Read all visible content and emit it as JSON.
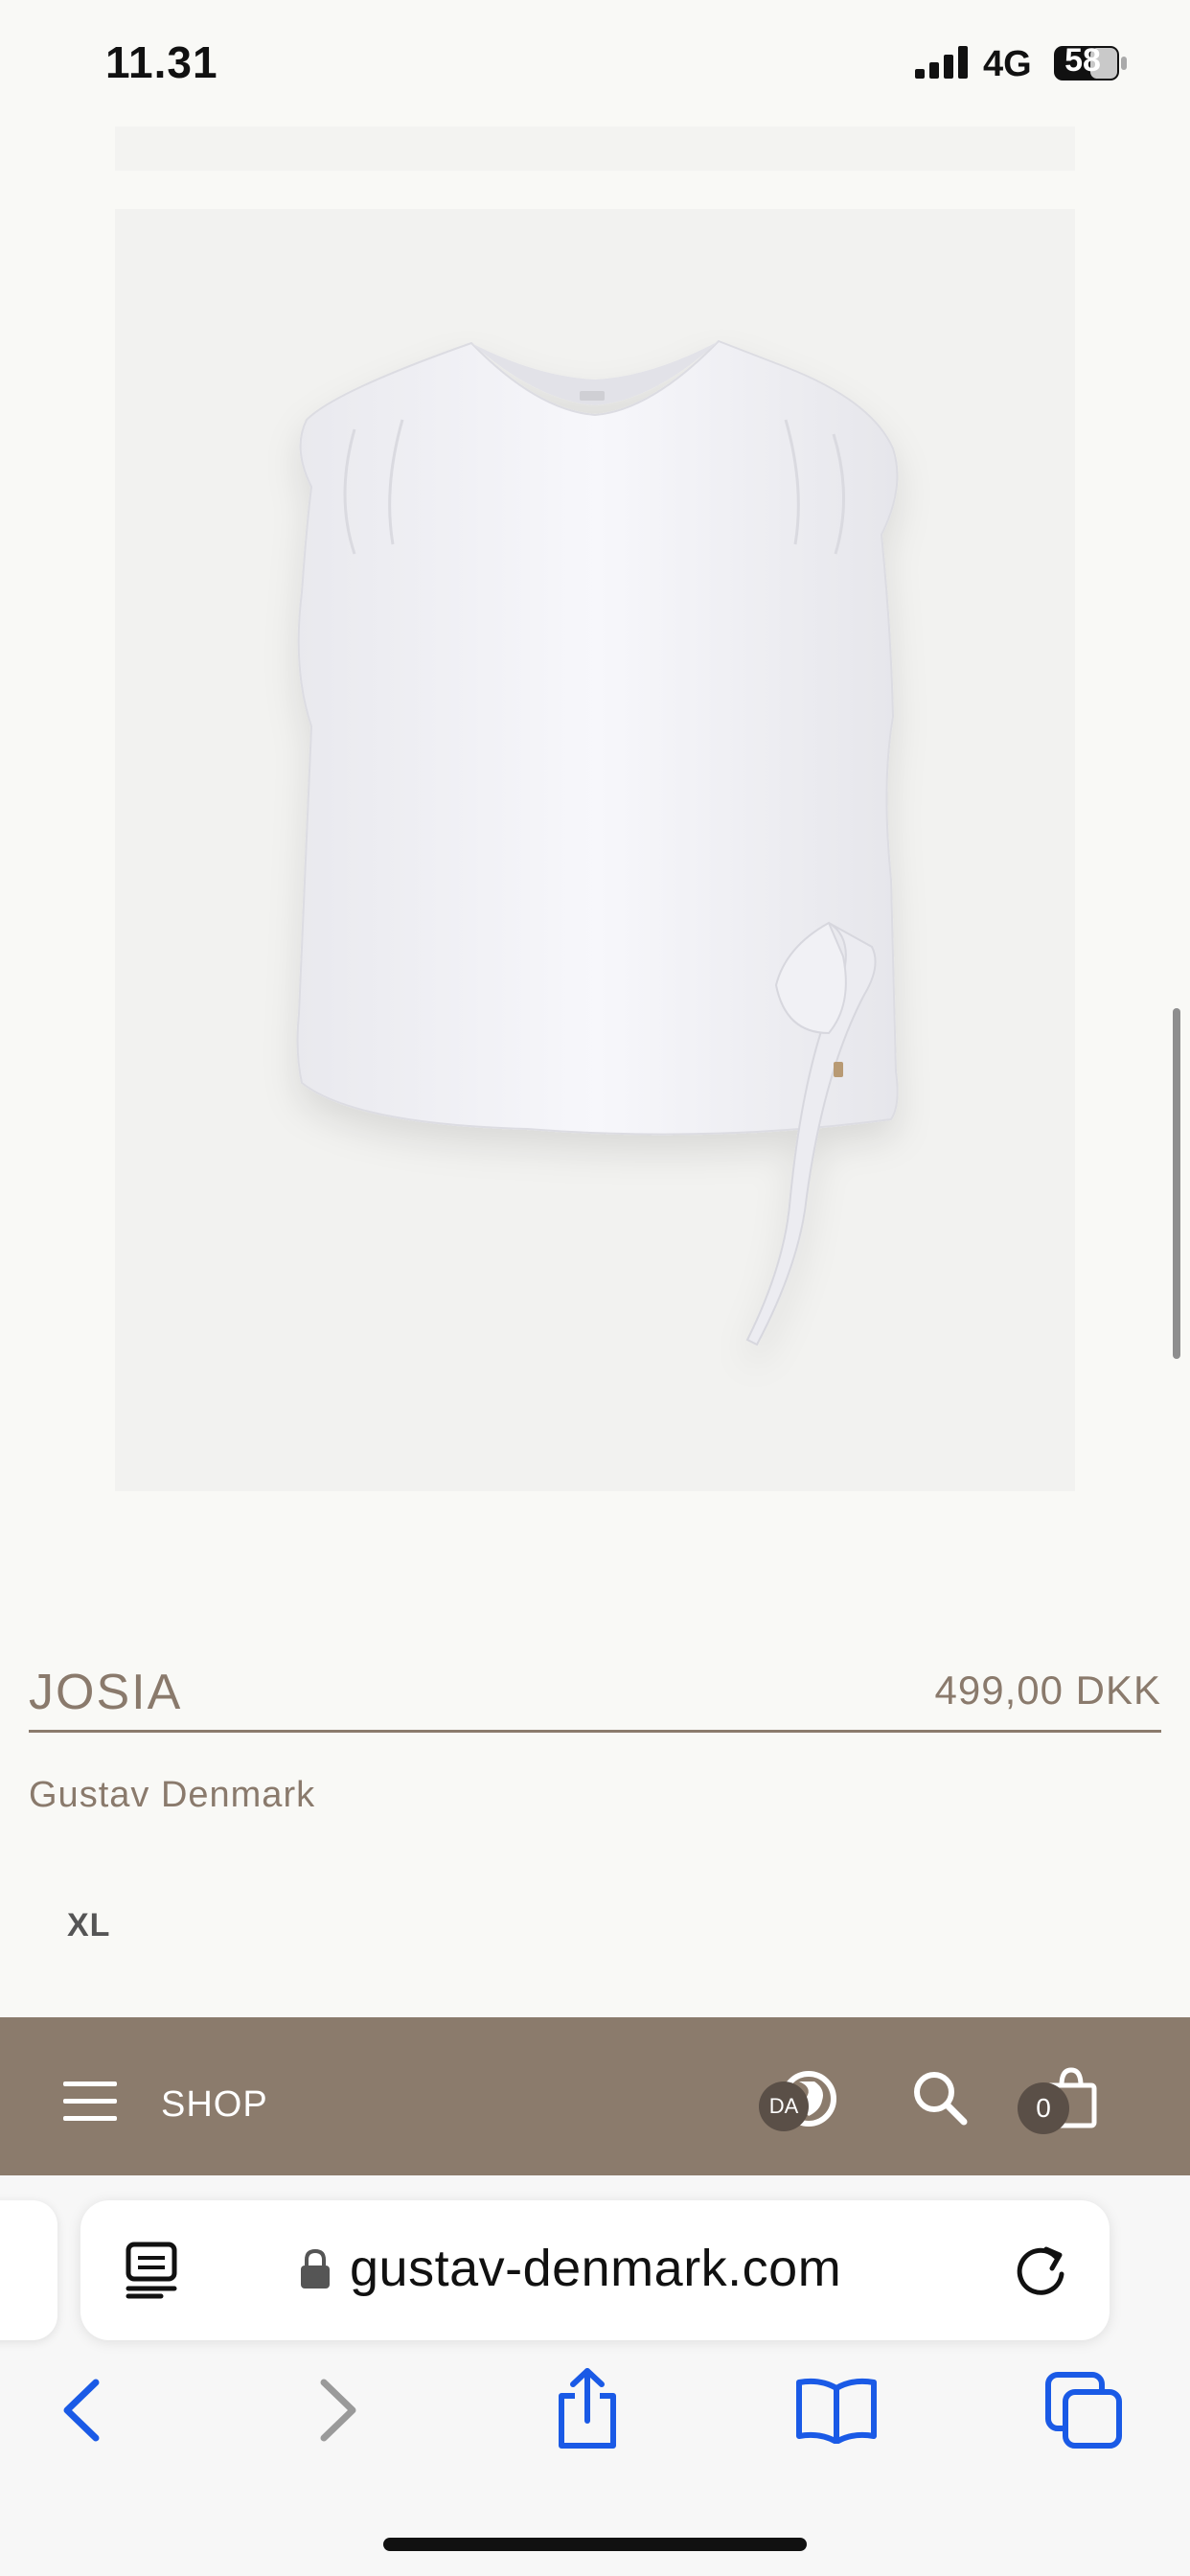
{
  "status_bar": {
    "time": "11.31",
    "network": "4G",
    "battery": "58"
  },
  "product": {
    "name": "JOSIA",
    "price": "499,00 DKK",
    "brand": "Gustav Denmark",
    "size": "XL"
  },
  "site_nav": {
    "menu_label": "SHOP",
    "language": "DA",
    "cart_count": "0"
  },
  "browser": {
    "url": "gustav-denmark.com"
  },
  "icons": [
    "signal-icon",
    "battery-icon",
    "menu-icon",
    "globe-icon",
    "search-icon",
    "bag-icon",
    "reader-icon",
    "lock-icon",
    "reload-icon",
    "back-icon",
    "forward-icon",
    "share-icon",
    "bookmarks-icon",
    "tabs-icon"
  ],
  "colors": {
    "page_background": "#f9f9f6",
    "brand_taupe": "#8b7b6c",
    "text_taupe": "#8a7a6c",
    "badge_dark": "#5a4f47",
    "ios_blue": "#1a5ae6"
  }
}
